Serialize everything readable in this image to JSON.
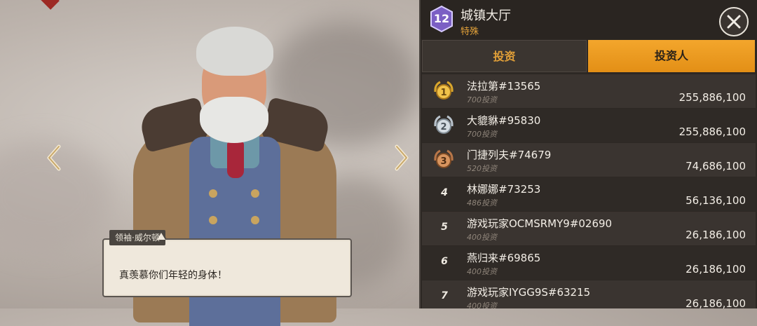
{
  "npc": {
    "speaker": "领袖·威尔顿",
    "dialogue": "真羡慕你们年轻的身体！"
  },
  "building": {
    "level": "12",
    "name": "城镇大厅",
    "type": "特殊"
  },
  "tabs": [
    {
      "label": "投资",
      "active": false
    },
    {
      "label": "投资人",
      "active": true
    }
  ],
  "leaderboard": [
    {
      "rank": "1",
      "name": "法拉第#13565",
      "investments": "700投资",
      "amount": "255,886,100",
      "medal": "gold"
    },
    {
      "rank": "2",
      "name": "大貔貅#95830",
      "investments": "700投资",
      "amount": "255,886,100",
      "medal": "silver"
    },
    {
      "rank": "3",
      "name": "门捷列夫#74679",
      "investments": "520投资",
      "amount": "74,686,100",
      "medal": "bronze"
    },
    {
      "rank": "4",
      "name": "林娜娜#73253",
      "investments": "486投资",
      "amount": "56,136,100",
      "medal": ""
    },
    {
      "rank": "5",
      "name": "游戏玩家OCMSRMY9#02690",
      "investments": "400投资",
      "amount": "26,186,100",
      "medal": ""
    },
    {
      "rank": "6",
      "name": "燕归来#69865",
      "investments": "400投资",
      "amount": "26,186,100",
      "medal": ""
    },
    {
      "rank": "7",
      "name": "游戏玩家IYGG9S#63215",
      "investments": "400投资",
      "amount": "26,186,100",
      "medal": ""
    }
  ],
  "colors": {
    "accent": "#e3a23a",
    "gold": "#d9a62c",
    "silver": "#b9c3cc",
    "bronze": "#b87648",
    "level_badge": "#7b5fc4"
  },
  "icons": {
    "close": "close-icon",
    "prev": "chevron-left-icon",
    "next": "chevron-right-icon"
  }
}
